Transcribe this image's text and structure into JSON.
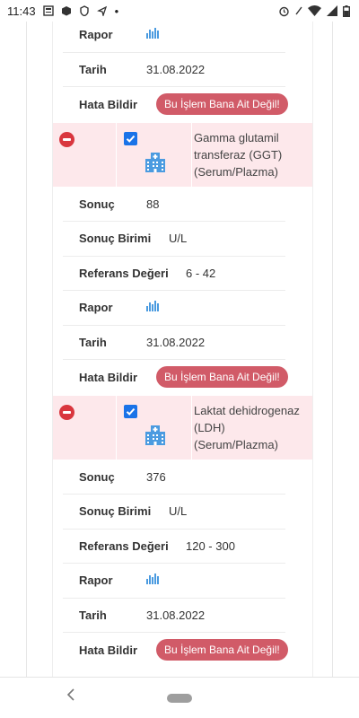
{
  "status_bar": {
    "time": "11:43",
    "dot": "•"
  },
  "tests": [
    {
      "rows": [
        {
          "label": "Rapor",
          "value": ""
        },
        {
          "label": "Tarih",
          "value": "31.08.2022"
        },
        {
          "label": "Hata Bildir",
          "button": "Bu İşlem Bana Ait Değil!"
        }
      ]
    },
    {
      "name": "Gamma glutamil transferaz (GGT) (Serum/Plazma)",
      "name_lines": [
        "Gamma glutamil",
        "transferaz (GGT)",
        "(Serum/Plazma)"
      ],
      "checked": true,
      "rows": [
        {
          "label": "Sonuç",
          "value": "88"
        },
        {
          "label": "Sonuç Birimi",
          "value": "U/L"
        },
        {
          "label": "Referans Değeri",
          "value": "6 - 42"
        },
        {
          "label": "Rapor",
          "value": ""
        },
        {
          "label": "Tarih",
          "value": "31.08.2022"
        },
        {
          "label": "Hata Bildir",
          "button": "Bu İşlem Bana Ait Değil!"
        }
      ]
    },
    {
      "name": "Laktat dehidrogenaz (LDH) (Serum/Plazma)",
      "name_lines": [
        "Laktat dehidrogenaz",
        "(LDH)",
        "(Serum/Plazma)"
      ],
      "checked": true,
      "rows": [
        {
          "label": "Sonuç",
          "value": "376"
        },
        {
          "label": "Sonuç Birimi",
          "value": "U/L"
        },
        {
          "label": "Referans Değeri",
          "value": "120 - 300"
        },
        {
          "label": "Rapor",
          "value": ""
        },
        {
          "label": "Tarih",
          "value": "31.08.2022"
        },
        {
          "label": "Hata Bildir",
          "button": "Bu İşlem Bana Ait Değil!"
        }
      ]
    }
  ],
  "colors": {
    "header_bg": "#fde8eb",
    "button_bg": "#d15b68",
    "remove_icon": "#d9363e",
    "checkbox": "#1a73e8",
    "chart_icon": "#4b9be0"
  },
  "icons": [
    "report-chart-icon",
    "hospital-building-icon",
    "remove-icon",
    "checkbox-checked-icon"
  ]
}
